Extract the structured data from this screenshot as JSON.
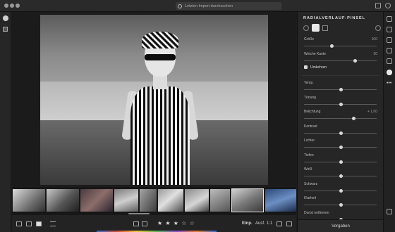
{
  "search": {
    "placeholder": "Letzten Import durchsuchen"
  },
  "panel": {
    "title": "RADIALVERLAUF-PINSEL",
    "rows_top": [
      {
        "label": "Größe",
        "value": "100",
        "knob": 0.38
      },
      {
        "label": "Weiche Kante",
        "value": "50",
        "knob": 0.7
      }
    ],
    "invert_label": "Umkehren",
    "invert_checked": true,
    "sliders": [
      {
        "label": "Temp.",
        "value": "",
        "knob": 0.5
      },
      {
        "label": "Tönung",
        "value": "",
        "knob": 0.5
      },
      {
        "label": "Belichtung",
        "value": "+ 1,00",
        "knob": 0.68
      },
      {
        "label": "Kontrast",
        "value": "",
        "knob": 0.5
      },
      {
        "label": "Lichter",
        "value": "",
        "knob": 0.5
      },
      {
        "label": "Tiefen",
        "value": "",
        "knob": 0.5
      },
      {
        "label": "Weiß",
        "value": "",
        "knob": 0.5
      },
      {
        "label": "Schwarz",
        "value": "",
        "knob": 0.5
      },
      {
        "label": "Klarheit",
        "value": "",
        "knob": 0.5
      },
      {
        "label": "Dunst entfernen",
        "value": "",
        "knob": 0.5
      }
    ],
    "presets_label": "Vorgaben"
  },
  "bottombar": {
    "stars": "★ ★ ★ ☆ ☆",
    "fit_label": "Einp.",
    "fill_label": "Ausf.",
    "ratio_label": "1:1"
  },
  "icons": {
    "left_rail": [
      "add-photos-icon",
      "library-icon"
    ],
    "right_rail": [
      "edit-icon",
      "crop-icon",
      "healing-icon",
      "brush-icon",
      "linear-gradient-icon",
      "radial-gradient-icon",
      "more-icon",
      "tag-icon"
    ]
  },
  "colors": {
    "accent": "#e6e6e6",
    "panel_bg": "#262626"
  }
}
